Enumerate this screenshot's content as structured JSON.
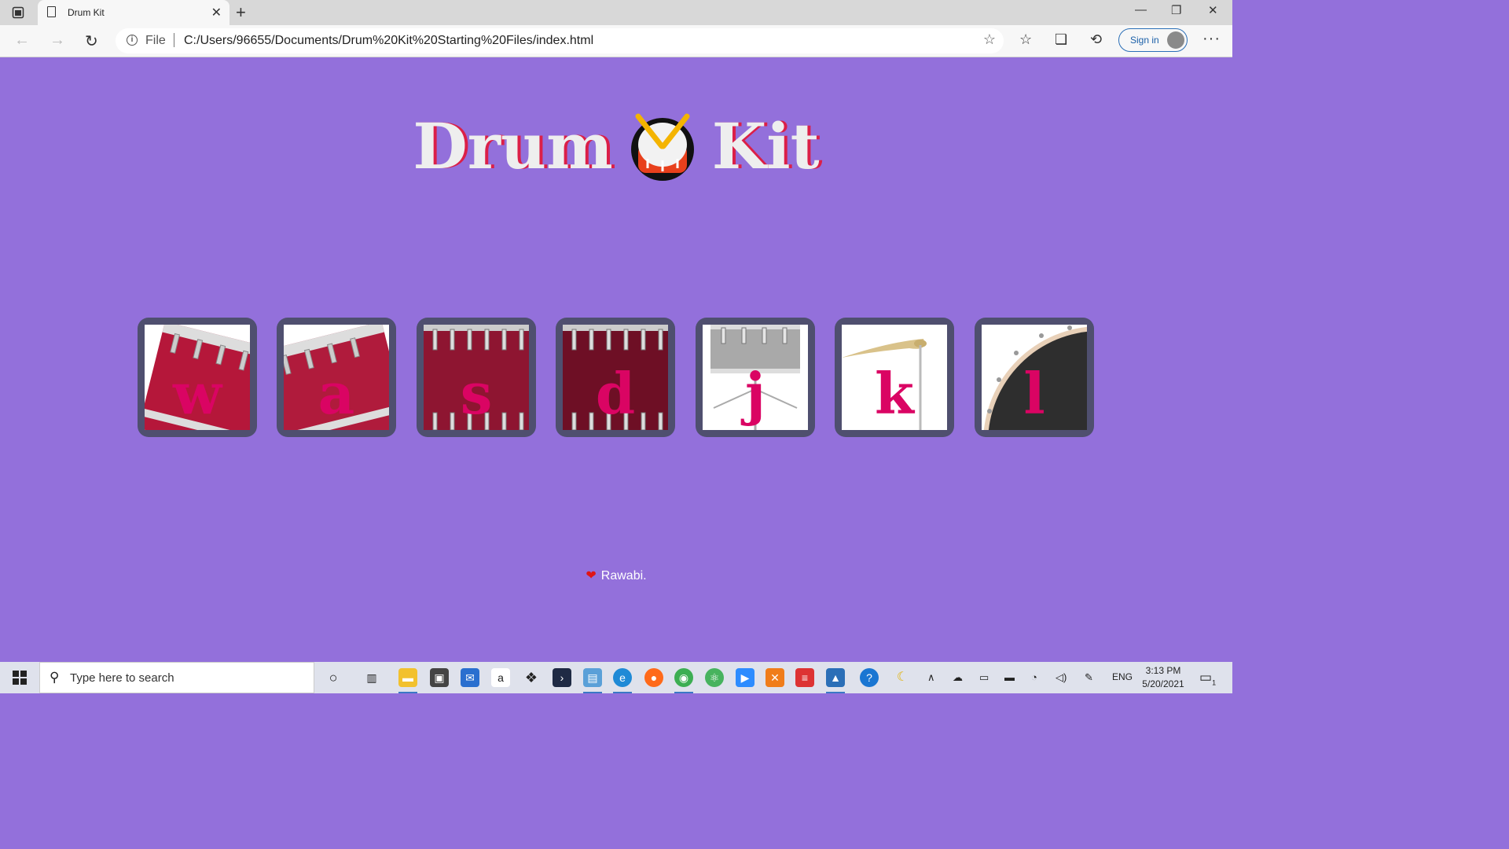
{
  "browser": {
    "tab_title": "Drum Kit",
    "file_label": "File",
    "url": "C:/Users/96655/Documents/Drum%20Kit%20Starting%20Files/index.html",
    "signin_label": "Sign in"
  },
  "page": {
    "title_left": "Drum",
    "title_right": "Kit",
    "drums": [
      {
        "key": "w",
        "image": "tom-1"
      },
      {
        "key": "a",
        "image": "tom-2"
      },
      {
        "key": "s",
        "image": "tom-3"
      },
      {
        "key": "d",
        "image": "tom-4"
      },
      {
        "key": "j",
        "image": "snare"
      },
      {
        "key": "k",
        "image": "crash"
      },
      {
        "key": "l",
        "image": "kick"
      }
    ],
    "footer_text": "Rawabi.",
    "colors": {
      "background": "#9370DB",
      "key": "#DA0463",
      "title": "#EEEEEE",
      "title_shadow": "#DB1F48",
      "drum_frame": "#4F4F6F"
    }
  },
  "taskbar": {
    "search_placeholder": "Type here to search",
    "language": "ENG",
    "time": "3:13 PM",
    "date": "5/20/2021",
    "notification_count": "1"
  }
}
